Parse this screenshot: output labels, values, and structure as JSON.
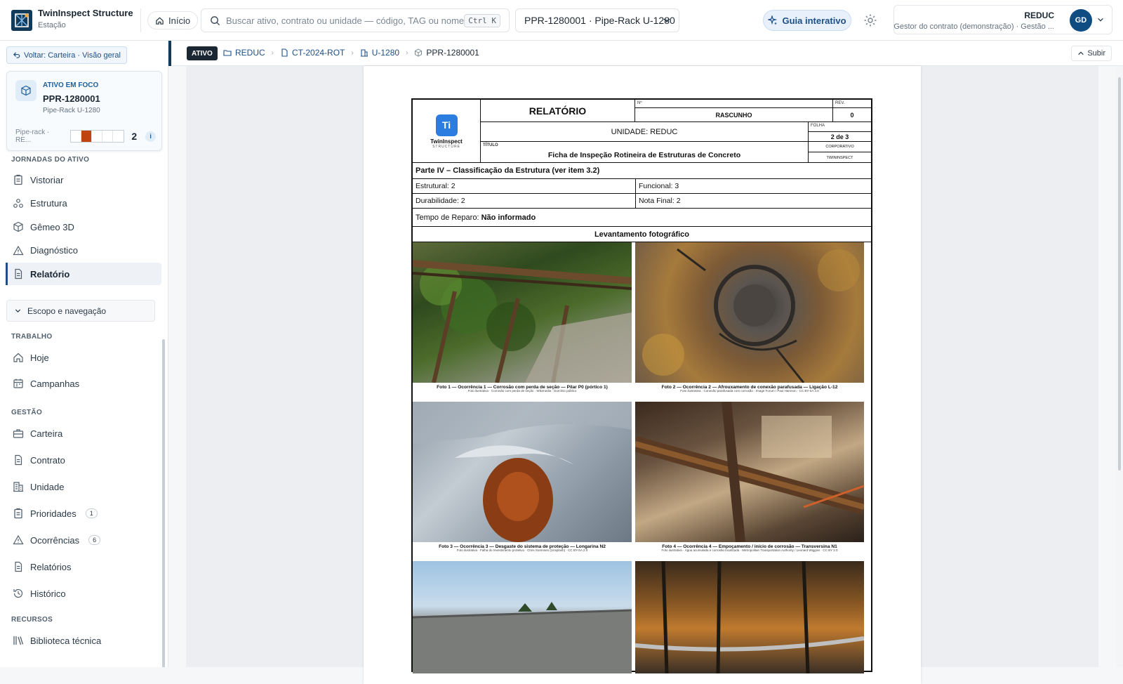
{
  "app": {
    "name": "TwinInspect Structure",
    "subtitle": "Estação"
  },
  "topbar": {
    "home_label": "Início",
    "search_placeholder": "Buscar ativo, contrato ou unidade — código, TAG ou nome",
    "search_shortcut": "Ctrl K",
    "asset_selected": "PPR-1280001 · Pipe-Rack U-1280",
    "guide_label": "Guia interativo",
    "user": {
      "org": "REDUC",
      "role": "Gestor do contrato (demonstração) · Gestão ...",
      "initials": "GD"
    }
  },
  "sidebar": {
    "back_label": "Voltar: Carteira · Visão geral",
    "focus": {
      "label": "ATIVO EM FOCO",
      "code": "PPR-1280001",
      "name": "Pipe-Rack U-1280",
      "meta": "Pipe-rack · RE...",
      "severity_level": 2,
      "severity_scale": 5,
      "count": "2",
      "info": "i"
    },
    "journeys_title": "JORNADAS DO ATIVO",
    "journeys": [
      {
        "label": "Vistoriar",
        "icon": "clipboard-icon"
      },
      {
        "label": "Estrutura",
        "icon": "structure-icon"
      },
      {
        "label": "Gêmeo 3D",
        "icon": "cube-icon"
      },
      {
        "label": "Diagnóstico",
        "icon": "warning-icon"
      },
      {
        "label": "Relatório",
        "icon": "document-icon",
        "active": true
      }
    ],
    "scope_label": "Escopo e navegação",
    "work_title": "TRABALHO",
    "work": [
      {
        "label": "Hoje",
        "icon": "home-icon"
      },
      {
        "label": "Campanhas",
        "icon": "calendar-icon"
      }
    ],
    "management_title": "GESTÃO",
    "management": [
      {
        "label": "Carteira",
        "icon": "briefcase-icon"
      },
      {
        "label": "Contrato",
        "icon": "document-icon"
      },
      {
        "label": "Unidade",
        "icon": "building-icon"
      },
      {
        "label": "Prioridades",
        "icon": "clipboard-icon",
        "badge": "1"
      },
      {
        "label": "Ocorrências",
        "icon": "warning-icon",
        "badge": "6"
      },
      {
        "label": "Relatórios",
        "icon": "document-icon"
      },
      {
        "label": "Histórico",
        "icon": "history-icon"
      }
    ],
    "resources_title": "RECURSOS",
    "resources": [
      {
        "label": "Biblioteca técnica",
        "icon": "library-icon"
      }
    ]
  },
  "breadcrumb": {
    "tag": "ATIVO",
    "items": [
      "REDUC",
      "CT-2024-ROT",
      "U-1280",
      "PPR-1280001"
    ],
    "up_label": "Subir"
  },
  "report": {
    "title": "RELATÓRIO",
    "n_label": "Nº",
    "rev_label": "REV.",
    "status": "RASCUNHO",
    "rev": "0",
    "unit": "UNIDADE: REDUC",
    "folha_label": "FOLHA",
    "folha": "2 de 3",
    "titulo_label": "TÍTULO",
    "titulo": "Ficha de Inspeção Rotineira de Estruturas de Concreto",
    "corp": "CORPORATIVO",
    "owner": "TWININSPECT",
    "logo_text": "Ti",
    "logo_name": "TwinInspect",
    "logo_sub": "STRUCTURE",
    "part": "Parte IV – Classificação da Estrutura (ver item 3.2)",
    "estrutural": "Estrutural: 2",
    "funcional": "Funcional: 3",
    "durabilidade": "Durabilidade: 2",
    "nota": "Nota Final: 2",
    "tempo_label": "Tempo de Reparo:",
    "tempo_value": "Não informado",
    "levantamento": "Levantamento fotográfico",
    "photos": [
      {
        "caption": "Foto 1 — Ocorrência 1 — Corrosão com perda de seção — Pilar P0 (pórtico 1)",
        "credit": "Foto ilustrativa · Corrosão com perda de seção · Wikimedia · Domínio público"
      },
      {
        "caption": "Foto 2 — Ocorrência 2 — Afrouxamento de conexão parafusada — Ligação L-12",
        "credit": "Foto ilustrativa · Conexão parafusada com corrosão · Image Forum / Paul Harrison · CC BY-SA 4.0"
      },
      {
        "caption": "Foto 3 — Ocorrência 3 — Desgaste do sistema de proteção — Longarina N2",
        "credit": "Foto ilustrativa · Falha do revestimento protetivo · Chris Sorensen (Unsplash) · CC BY-SA 2.0"
      },
      {
        "caption": "Foto 4 — Ocorrência 4 — Empoçamento / início de corrosão — Transversina N1",
        "credit": "Foto ilustrativa · Água acumulada e corrosão localizada · Metropolitan Transportation Authority / Leonard Wiggins · CC BY 2.0"
      }
    ]
  }
}
